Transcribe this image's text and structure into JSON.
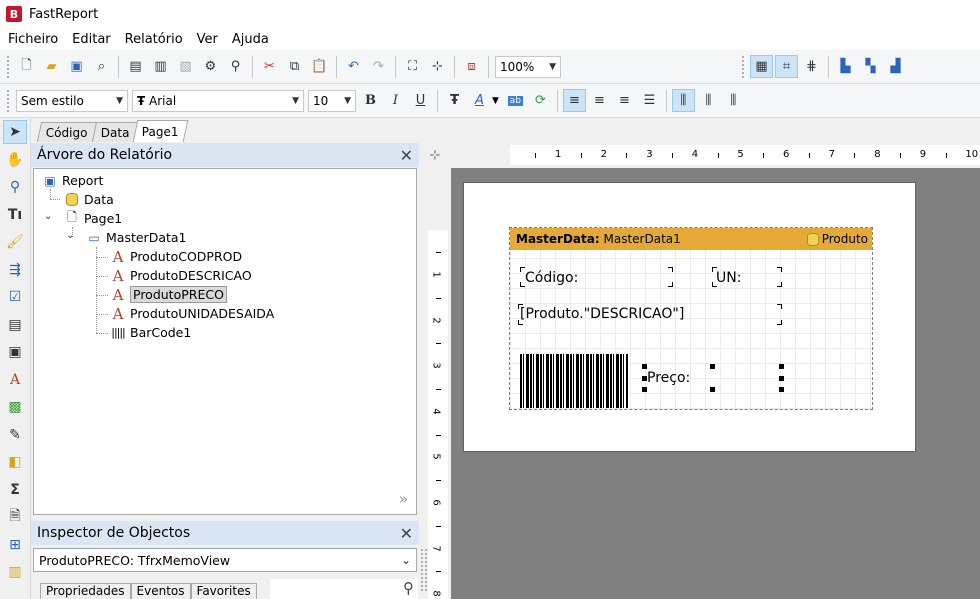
{
  "window": {
    "title": "FastReport",
    "logo_letter": "B"
  },
  "menu": [
    "Ficheiro",
    "Editar",
    "Relatório",
    "Ver",
    "Ajuda"
  ],
  "toolbar1": {
    "zoom": "100%"
  },
  "toolbar2": {
    "style": "Sem estilo",
    "font": "Arial",
    "font_size": "10",
    "bold": "B",
    "italic": "I",
    "underline": "U"
  },
  "tabs": [
    "Código",
    "Data",
    "Page1"
  ],
  "tree_panel": {
    "title": "Árvore do Relatório",
    "items": [
      {
        "label": "Report"
      },
      {
        "label": "Data"
      },
      {
        "label": "Page1"
      },
      {
        "label": "MasterData1"
      },
      {
        "label": "ProdutoCODPROD"
      },
      {
        "label": "ProdutoDESCRICAO"
      },
      {
        "label": "ProdutoPRECO"
      },
      {
        "label": "ProdutoUNIDADESAIDA"
      },
      {
        "label": "BarCode1"
      }
    ]
  },
  "inspector": {
    "title": "Inspector de Objectos",
    "selected": "ProdutoPRECO: TfrxMemoView",
    "tabs": [
      "Propriedades",
      "Eventos",
      "Favorites"
    ]
  },
  "ruler_h": [
    "1",
    "2",
    "3",
    "4",
    "5",
    "6",
    "7",
    "8",
    "9",
    "10"
  ],
  "ruler_v": [
    "1",
    "2",
    "3",
    "4",
    "5",
    "6",
    "7",
    "8"
  ],
  "band": {
    "type_label": "MasterData:",
    "name": "MasterData1",
    "dataset": "Produto"
  },
  "memos": {
    "codigo": "Código:",
    "un": "UN:",
    "descricao": "[Produto.\"DESCRICAO\"]",
    "preco": "Preço:"
  }
}
